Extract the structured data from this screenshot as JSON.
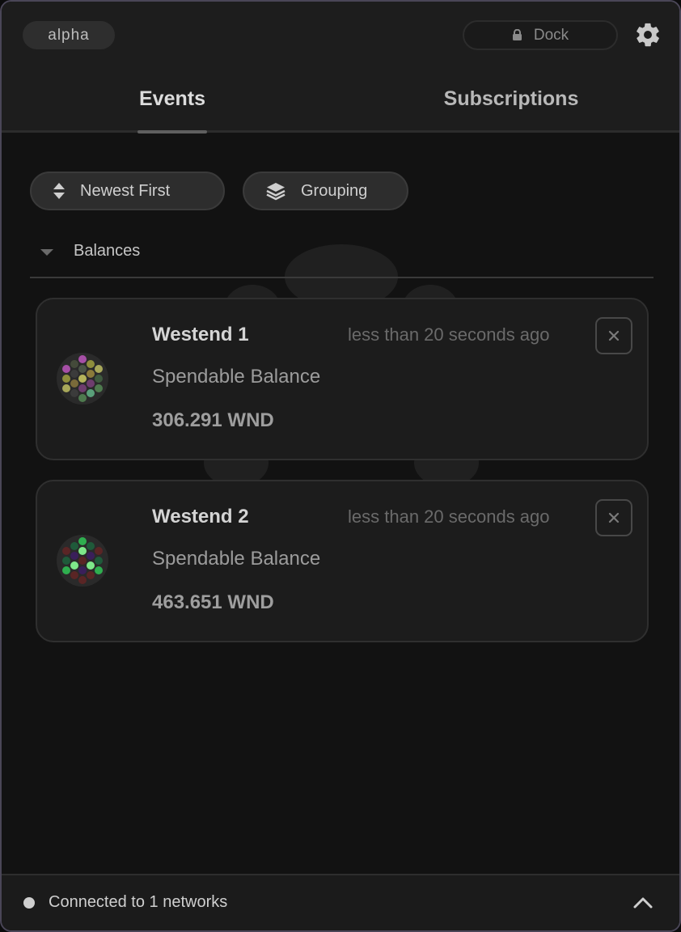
{
  "header": {
    "mode_label": "alpha",
    "dock_label": "Dock",
    "tabs": [
      {
        "label": "Events",
        "active": true
      },
      {
        "label": "Subscriptions",
        "active": false
      }
    ]
  },
  "controls": {
    "sort_label": "Newest First",
    "grouping_label": "Grouping"
  },
  "groups": [
    {
      "label": "Balances",
      "events": [
        {
          "title": "Westend 1",
          "time": "less than 20 seconds ago",
          "subtitle": "Spendable Balance",
          "value": "306.291 WND"
        },
        {
          "title": "Westend 2",
          "time": "less than 20 seconds ago",
          "subtitle": "Spendable Balance",
          "value": "463.651 WND"
        }
      ]
    }
  ],
  "footer": {
    "status_text": "Connected to 1 networks"
  },
  "colors": {
    "background": "#121212",
    "surface": "#1c1c1c",
    "accent_tab_underline": "#5f5f5f",
    "status_dot": "#cfcfcf"
  },
  "icons": {
    "dock": "lock-icon",
    "settings": "gear-icon",
    "sort": "sort-icon",
    "grouping": "layers-icon",
    "collapse": "caret-down-icon",
    "dismiss": "close-icon",
    "expand_footer": "chevron-up-icon"
  }
}
